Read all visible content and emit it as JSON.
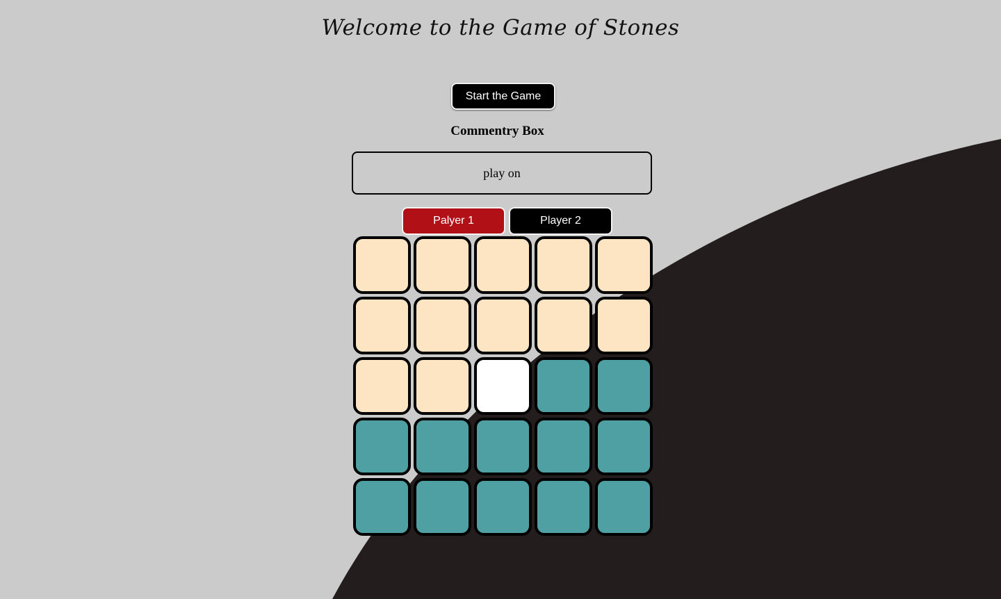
{
  "title": "Welcome to the Game of Stones",
  "start_button": "Start the Game",
  "commentary": {
    "heading": "Commentry Box",
    "text": "play on"
  },
  "players": [
    {
      "label": "Palyer 1",
      "color": "#b11116"
    },
    {
      "label": "Player 2",
      "color": "#000000"
    }
  ],
  "colors": {
    "background": "#cbcbcb",
    "dark_swoosh": "#231d1d",
    "empty": "#fde5c3",
    "selected": "#ffffff",
    "stone": "#4ea0a2"
  },
  "board": {
    "rows": 5,
    "cols": 5,
    "cells": [
      [
        "empty",
        "empty",
        "empty",
        "empty",
        "empty"
      ],
      [
        "empty",
        "empty",
        "empty",
        "empty",
        "empty"
      ],
      [
        "empty",
        "empty",
        "selected",
        "stone",
        "stone"
      ],
      [
        "stone",
        "stone",
        "stone",
        "stone",
        "stone"
      ],
      [
        "stone",
        "stone",
        "stone",
        "stone",
        "stone"
      ]
    ]
  }
}
